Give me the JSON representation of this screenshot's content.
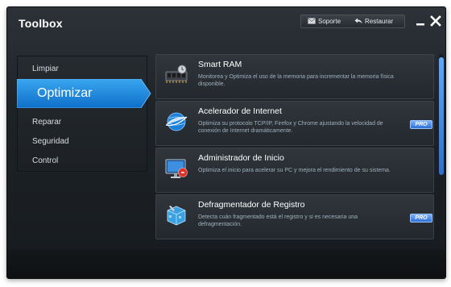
{
  "window": {
    "title": "Toolbox"
  },
  "top_actions": {
    "support_label": "Soporte",
    "restore_label": "Restaurar"
  },
  "sidebar": {
    "items": [
      {
        "label": "Limpiar",
        "active": false
      },
      {
        "label": "Optimizar",
        "active": true
      },
      {
        "label": "Reparar",
        "active": false
      },
      {
        "label": "Seguridad",
        "active": false
      },
      {
        "label": "Control",
        "active": false
      }
    ]
  },
  "cards": [
    {
      "title": "Smart RAM",
      "description": "Monitorea y Optimiza el uso de la memoria para incrementar la memoria física disponible.",
      "icon": "ram-icon",
      "pro": ""
    },
    {
      "title": "Acelerador de Internet",
      "description": "Optimiza su protocolo TCP/IP, Firefox y Chrome ajustando la velocidad de conexión de Internet dramáticamente.",
      "icon": "internet-icon",
      "pro": "PRO"
    },
    {
      "title": "Administrador de Inicio",
      "description": "Optimiza el inicio para acelerar su PC y mejora el rendimiento de su sistema.",
      "icon": "startup-monitor-icon",
      "pro": ""
    },
    {
      "title": "Defragmentador de Registro",
      "description": "Detecta cuán fragmentado está el registro y si es necesaria una defragmentación.",
      "icon": "registry-cube-icon",
      "pro": "PRO"
    }
  ],
  "colors": {
    "accent": "#1e8fe0",
    "pro_badge": "#2e6fd6",
    "background": "#1d2227"
  }
}
